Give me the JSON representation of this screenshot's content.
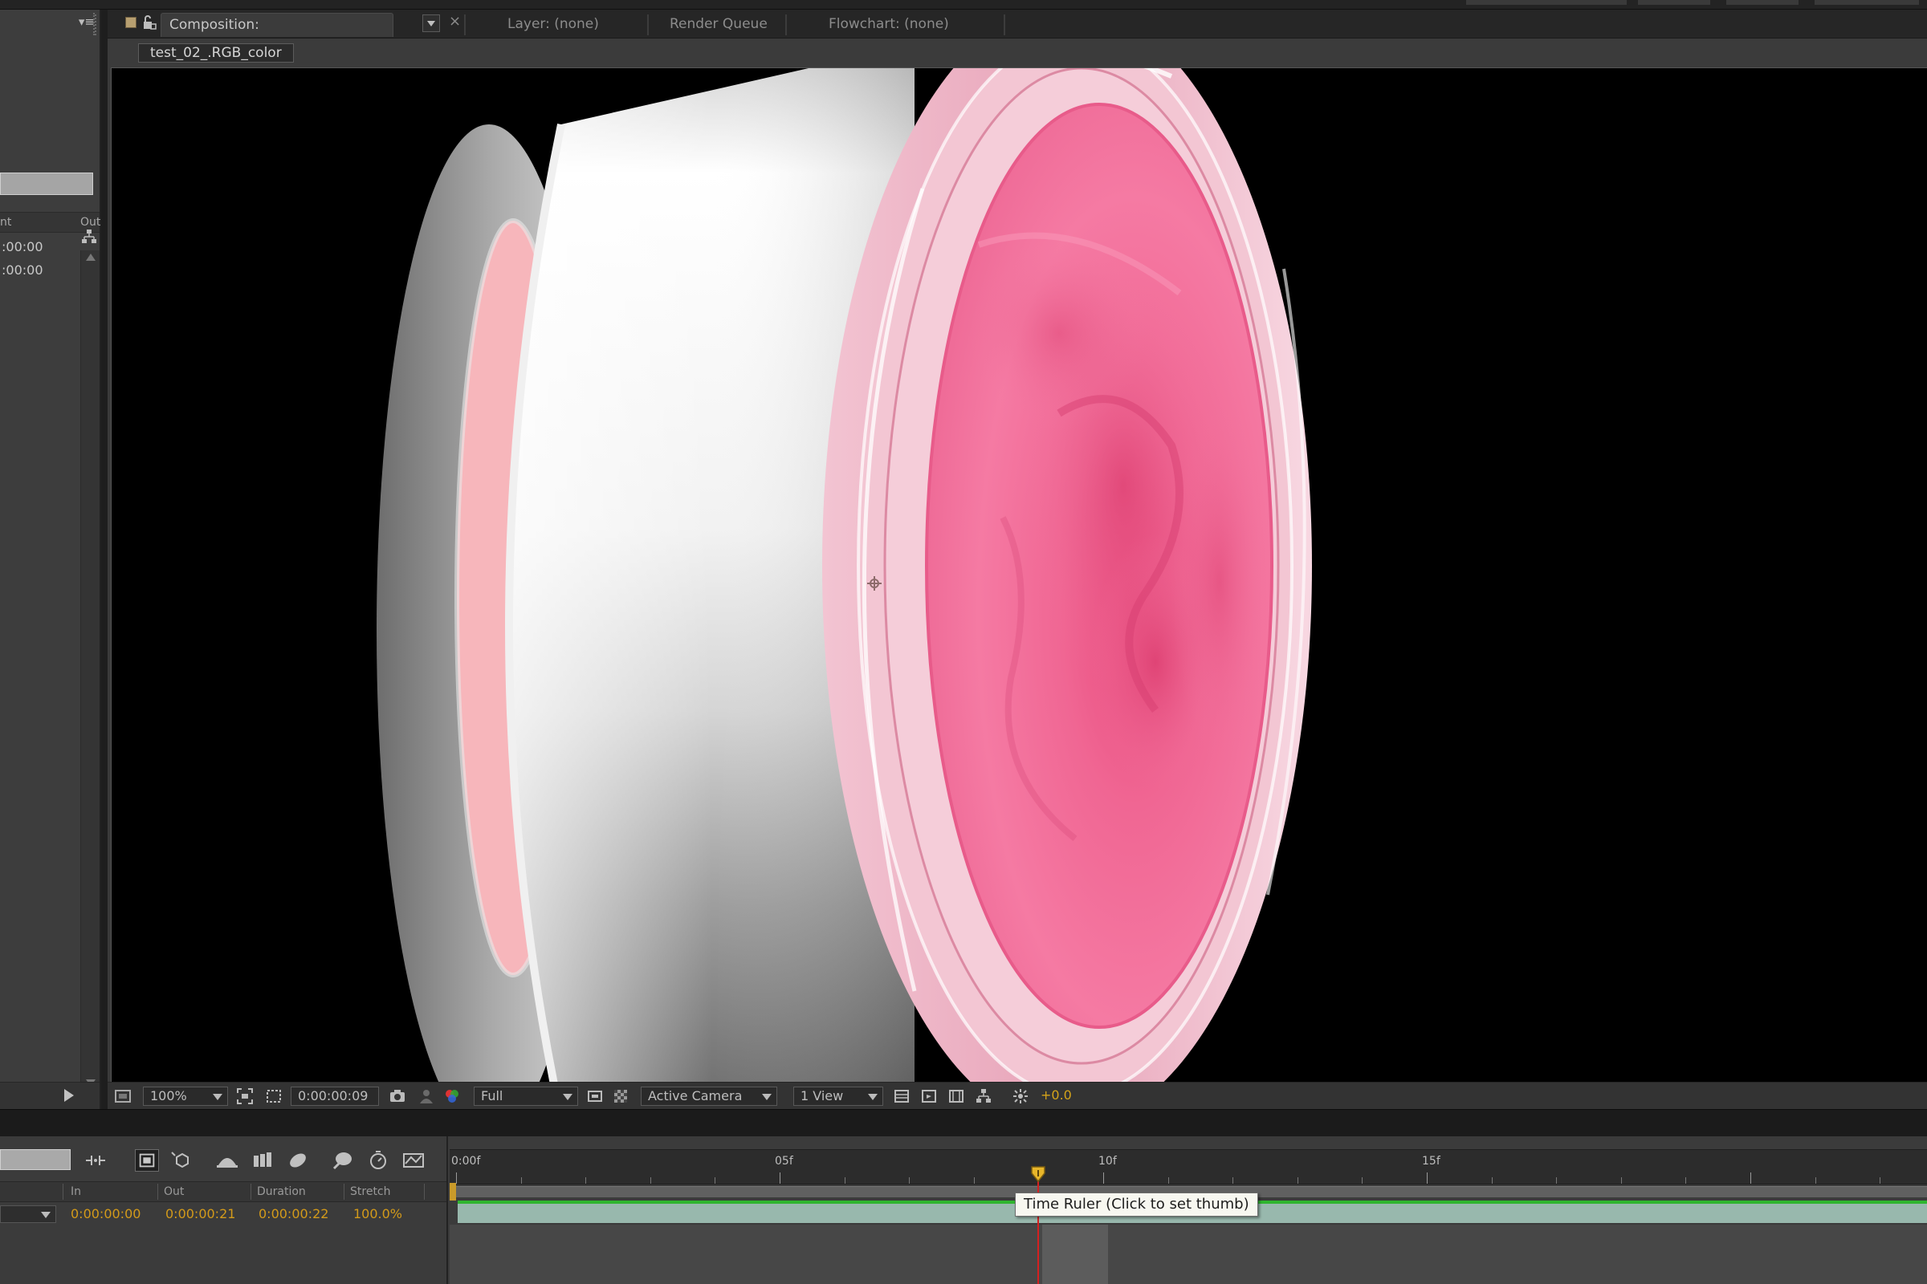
{
  "tabs": {
    "composition": "Composition: test_02_.RGB_color",
    "layer": "Layer: (none)",
    "render_queue": "Render Queue",
    "flowchart": "Flowchart: (none)"
  },
  "breadcrumb": "test_02_.RGB_color",
  "project_panel": {
    "column_headers": [
      "nt",
      "Out"
    ],
    "rows": [
      ":00:00",
      ":00:00"
    ]
  },
  "viewer_toolbar": {
    "magnification": "100%",
    "current_time": "0:00:00:09",
    "resolution": "Full",
    "camera": "Active Camera",
    "views": "1 View",
    "exposure": "+0.0"
  },
  "timeline": {
    "columns": [
      "In",
      "Out",
      "Duration",
      "Stretch"
    ],
    "layer": {
      "in": "0:00:00:00",
      "out": "0:00:00:21",
      "duration": "0:00:00:22",
      "stretch": "100.0%"
    },
    "ruler_labels": [
      "0:00f",
      "05f",
      "10f",
      "15f"
    ],
    "current_frame": 9,
    "tooltip": "Time Ruler (Click to set thumb)"
  },
  "colors": {
    "accent_orange": "#d4a31a",
    "playhead_red": "#d42020",
    "layer_bar": "#98b8ad",
    "cream_pink": "#f36a9a"
  }
}
